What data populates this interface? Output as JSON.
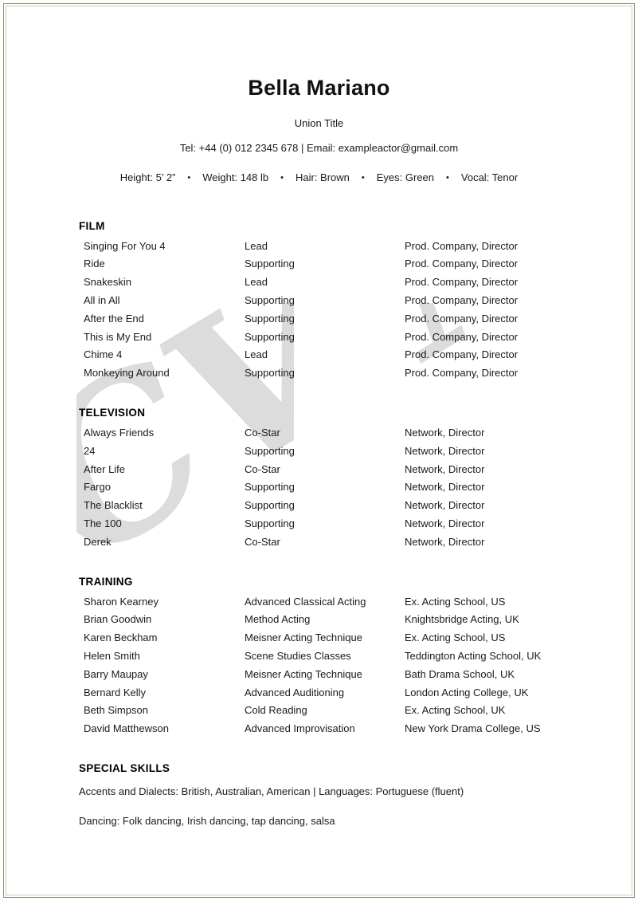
{
  "header": {
    "name": "Bella Mariano",
    "union_title": "Union Title",
    "contact": "Tel: +44 (0) 012 2345 678 | Email: exampleactor@gmail.com",
    "stats": [
      "Height: 5’ 2”",
      "Weight: 148 lb",
      "Hair: Brown",
      "Eyes: Green",
      "Vocal: Tenor"
    ],
    "stat_separator": "•"
  },
  "watermark": {
    "text": "CV Nation",
    "color": "#dcdcdc"
  },
  "sections": {
    "film": {
      "title": "FILM",
      "rows": [
        {
          "title": "Singing For You 4",
          "role": "Lead",
          "production": "Prod. Company, Director"
        },
        {
          "title": "Ride",
          "role": "Supporting",
          "production": "Prod. Company, Director"
        },
        {
          "title": "Snakeskin",
          "role": "Lead",
          "production": "Prod. Company, Director"
        },
        {
          "title": "All in All",
          "role": "Supporting",
          "production": "Prod. Company, Director"
        },
        {
          "title": "After the End",
          "role": "Supporting",
          "production": "Prod. Company, Director"
        },
        {
          "title": "This is My End",
          "role": "Supporting",
          "production": "Prod. Company, Director"
        },
        {
          "title": "Chime 4",
          "role": "Lead",
          "production": "Prod. Company, Director"
        },
        {
          "title": "Monkeying Around",
          "role": "Supporting",
          "production": "Prod. Company, Director"
        }
      ]
    },
    "television": {
      "title": "TELEVISION",
      "rows": [
        {
          "title": "Always Friends",
          "role": "Co-Star",
          "production": "Network, Director"
        },
        {
          "title": "24",
          "role": "Supporting",
          "production": "Network, Director"
        },
        {
          "title": "After Life",
          "role": "Co-Star",
          "production": "Network, Director"
        },
        {
          "title": "Fargo",
          "role": "Supporting",
          "production": "Network, Director"
        },
        {
          "title": "The Blacklist",
          "role": "Supporting",
          "production": "Network, Director"
        },
        {
          "title": "The 100",
          "role": "Supporting",
          "production": "Network, Director"
        },
        {
          "title": "Derek",
          "role": "Co-Star",
          "production": "Network, Director"
        }
      ]
    },
    "training": {
      "title": "TRAINING",
      "rows": [
        {
          "title": "Sharon Kearney",
          "role": "Advanced Classical Acting",
          "production": "Ex. Acting School, US"
        },
        {
          "title": "Brian Goodwin",
          "role": "Method Acting",
          "production": "Knightsbridge Acting, UK"
        },
        {
          "title": "Karen Beckham",
          "role": "Meisner Acting Technique",
          "production": "Ex. Acting School, US"
        },
        {
          "title": "Helen Smith",
          "role": "Scene Studies Classes",
          "production": "Teddington Acting School, UK"
        },
        {
          "title": "Barry Maupay",
          "role": "Meisner Acting Technique",
          "production": "Bath Drama School, UK"
        },
        {
          "title": "Bernard Kelly",
          "role": "Advanced Auditioning",
          "production": "London Acting College, UK"
        },
        {
          "title": "Beth Simpson",
          "role": "Cold Reading",
          "production": "Ex. Acting School, UK"
        },
        {
          "title": "David Matthewson",
          "role": "Advanced Improvisation",
          "production": "New York Drama College, US"
        }
      ]
    },
    "special_skills": {
      "title": "SPECIAL SKILLS",
      "lines": [
        "Accents and Dialects: British, Australian, American | Languages: Portuguese (fluent)",
        "Dancing: Folk dancing, Irish dancing, tap dancing, salsa"
      ]
    }
  }
}
